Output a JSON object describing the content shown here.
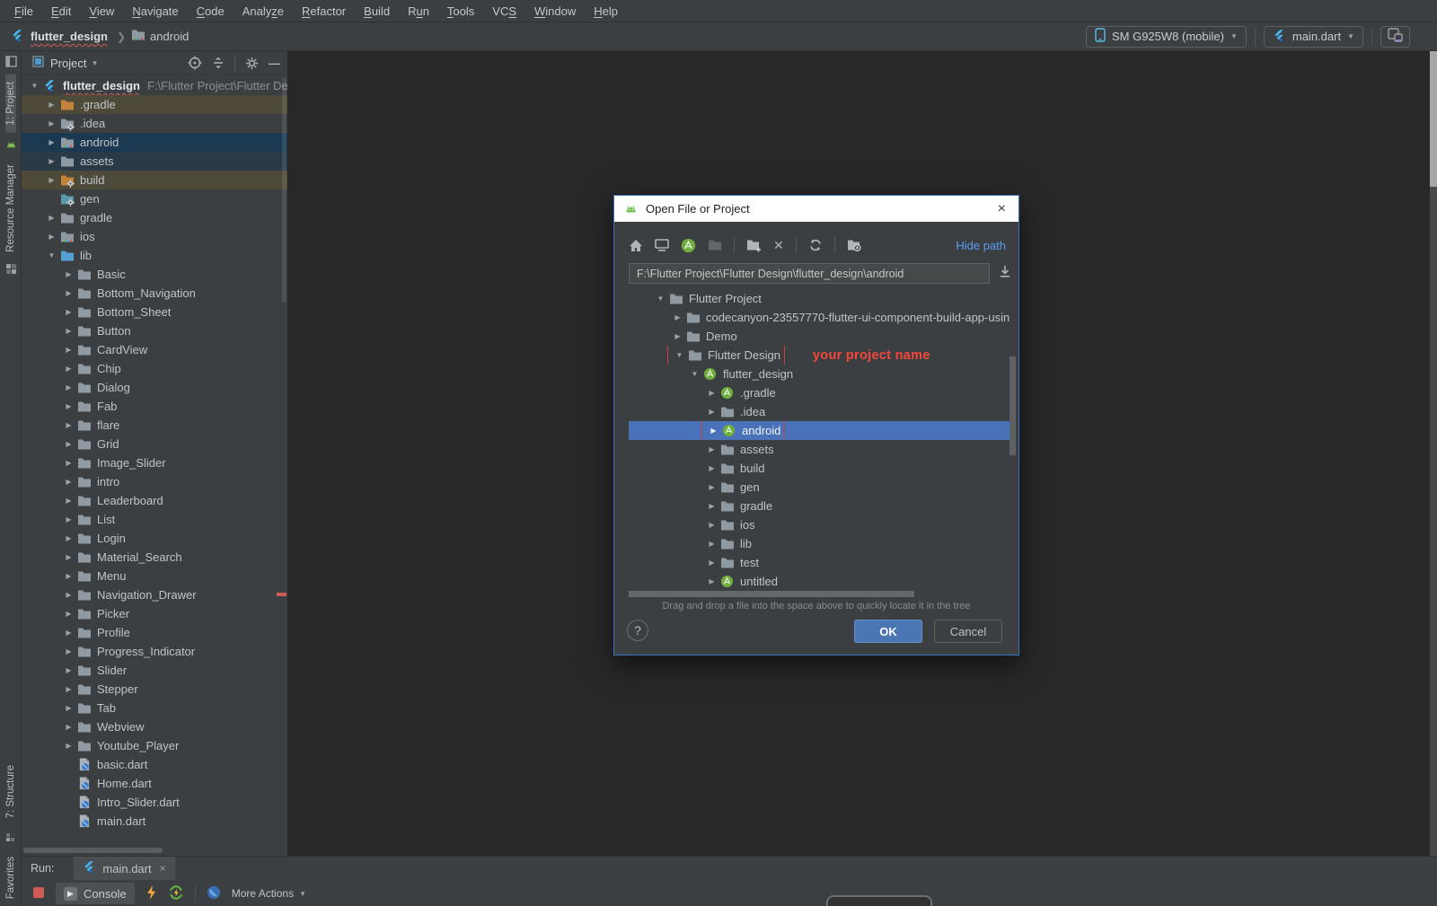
{
  "menu_bar": {
    "items": [
      {
        "label": "File",
        "u": 0
      },
      {
        "label": "Edit",
        "u": 0
      },
      {
        "label": "View",
        "u": 0
      },
      {
        "label": "Navigate",
        "u": 0
      },
      {
        "label": "Code",
        "u": 0
      },
      {
        "label": "Analyze",
        "u": 5
      },
      {
        "label": "Refactor",
        "u": 0
      },
      {
        "label": "Build",
        "u": 0
      },
      {
        "label": "Run",
        "u": 1
      },
      {
        "label": "Tools",
        "u": 0
      },
      {
        "label": "VCS",
        "u": 2
      },
      {
        "label": "Window",
        "u": 0
      },
      {
        "label": "Help",
        "u": 0
      }
    ]
  },
  "breadcrumb": {
    "project": "flutter_design",
    "node": "android"
  },
  "header_right": {
    "device": "SM G925W8 (mobile)",
    "run_config": "main.dart"
  },
  "tool_strip": {
    "top": [
      {
        "icon": "project-tab"
      },
      {
        "label": "1: Project",
        "active": true
      },
      {
        "icon": "android-bot"
      },
      {
        "label": "Resource Manager"
      },
      {
        "icon": "resource-manager"
      }
    ],
    "bottom": [
      {
        "label": "7: Structure"
      },
      {
        "icon": "structure"
      },
      {
        "label": "Favorites"
      }
    ]
  },
  "project_panel": {
    "title": "Project",
    "tree": [
      {
        "name": "flutter_design",
        "depth": 0,
        "icon": "flutter",
        "expanded": true,
        "bold": true,
        "squiggle": true,
        "path": "F:\\Flutter Project\\Flutter Desig"
      },
      {
        "name": ".gradle",
        "depth": 1,
        "icon": "folder-orange",
        "expanded": false,
        "row": "row-olive"
      },
      {
        "name": ".idea",
        "depth": 1,
        "icon": "folder-gear",
        "expanded": false
      },
      {
        "name": "android",
        "depth": 1,
        "icon": "folder-android",
        "expanded": false,
        "row": "row-selleft"
      },
      {
        "name": "assets",
        "depth": 1,
        "icon": "folder",
        "expanded": false,
        "row": "row-dimblue"
      },
      {
        "name": "build",
        "depth": 1,
        "icon": "folder-orange-gear",
        "expanded": false,
        "row": "row-olive"
      },
      {
        "name": "gen",
        "depth": 1,
        "icon": "folder-teal-gear",
        "expanded": null
      },
      {
        "name": "gradle",
        "depth": 1,
        "icon": "folder",
        "expanded": false
      },
      {
        "name": "ios",
        "depth": 1,
        "icon": "folder-android",
        "expanded": false
      },
      {
        "name": "lib",
        "depth": 1,
        "icon": "folder-blue",
        "expanded": true
      },
      {
        "name": "Basic",
        "depth": 2,
        "icon": "folder",
        "expanded": false
      },
      {
        "name": "Bottom_Navigation",
        "depth": 2,
        "icon": "folder",
        "expanded": false
      },
      {
        "name": "Bottom_Sheet",
        "depth": 2,
        "icon": "folder",
        "expanded": false
      },
      {
        "name": "Button",
        "depth": 2,
        "icon": "folder",
        "expanded": false
      },
      {
        "name": "CardView",
        "depth": 2,
        "icon": "folder",
        "expanded": false
      },
      {
        "name": "Chip",
        "depth": 2,
        "icon": "folder",
        "expanded": false
      },
      {
        "name": "Dialog",
        "depth": 2,
        "icon": "folder",
        "expanded": false
      },
      {
        "name": "Fab",
        "depth": 2,
        "icon": "folder",
        "expanded": false
      },
      {
        "name": "flare",
        "depth": 2,
        "icon": "folder",
        "expanded": false
      },
      {
        "name": "Grid",
        "depth": 2,
        "icon": "folder",
        "expanded": false
      },
      {
        "name": "Image_Slider",
        "depth": 2,
        "icon": "folder",
        "expanded": false
      },
      {
        "name": "intro",
        "depth": 2,
        "icon": "folder",
        "expanded": false
      },
      {
        "name": "Leaderboard",
        "depth": 2,
        "icon": "folder",
        "expanded": false
      },
      {
        "name": "List",
        "depth": 2,
        "icon": "folder",
        "expanded": false
      },
      {
        "name": "Login",
        "depth": 2,
        "icon": "folder",
        "expanded": false
      },
      {
        "name": "Material_Search",
        "depth": 2,
        "icon": "folder",
        "expanded": false
      },
      {
        "name": "Menu",
        "depth": 2,
        "icon": "folder",
        "expanded": false
      },
      {
        "name": "Navigation_Drawer",
        "depth": 2,
        "icon": "folder",
        "expanded": false
      },
      {
        "name": "Picker",
        "depth": 2,
        "icon": "folder",
        "expanded": false
      },
      {
        "name": "Profile",
        "depth": 2,
        "icon": "folder",
        "expanded": false
      },
      {
        "name": "Progress_Indicator",
        "depth": 2,
        "icon": "folder",
        "expanded": false
      },
      {
        "name": "Slider",
        "depth": 2,
        "icon": "folder",
        "expanded": false
      },
      {
        "name": "Stepper",
        "depth": 2,
        "icon": "folder",
        "expanded": false
      },
      {
        "name": "Tab",
        "depth": 2,
        "icon": "folder",
        "expanded": false
      },
      {
        "name": "Webview",
        "depth": 2,
        "icon": "folder",
        "expanded": false
      },
      {
        "name": "Youtube_Player",
        "depth": 2,
        "icon": "folder",
        "expanded": false
      },
      {
        "name": "basic.dart",
        "depth": 2,
        "icon": "dart",
        "expanded": null
      },
      {
        "name": "Home.dart",
        "depth": 2,
        "icon": "dart",
        "expanded": null
      },
      {
        "name": "Intro_Slider.dart",
        "depth": 2,
        "icon": "dart",
        "expanded": null
      },
      {
        "name": "main.dart",
        "depth": 2,
        "icon": "dart",
        "expanded": null
      }
    ]
  },
  "dialog": {
    "title": "Open File or Project",
    "hide_path_label": "Hide path",
    "path_value": "F:\\Flutter Project\\Flutter Design\\flutter_design\\android",
    "annotation": "your project name",
    "hint": "Drag and drop a file into the space above to quickly locate it in the tree",
    "help_label": "?",
    "ok_label": "OK",
    "cancel_label": "Cancel",
    "close_label": "×",
    "tree": [
      {
        "name": "Flutter Project",
        "depth": 0,
        "icon": "folder",
        "expanded": true
      },
      {
        "name": "codecanyon-23557770-flutter-ui-component-build-app-usin",
        "depth": 1,
        "icon": "folder",
        "expanded": false
      },
      {
        "name": "Demo",
        "depth": 1,
        "icon": "folder",
        "expanded": false
      },
      {
        "name": "Flutter Design",
        "depth": 1,
        "icon": "folder",
        "expanded": true,
        "box": true,
        "note": "your project name"
      },
      {
        "name": "flutter_design",
        "depth": 2,
        "icon": "as",
        "expanded": true
      },
      {
        "name": ".gradle",
        "depth": 3,
        "icon": "as",
        "expanded": false
      },
      {
        "name": ".idea",
        "depth": 3,
        "icon": "folder",
        "expanded": false
      },
      {
        "name": "android",
        "depth": 3,
        "icon": "as",
        "expanded": false,
        "row": "row-selblue",
        "box": true
      },
      {
        "name": "assets",
        "depth": 3,
        "icon": "folder",
        "expanded": false
      },
      {
        "name": "build",
        "depth": 3,
        "icon": "folder",
        "expanded": false
      },
      {
        "name": "gen",
        "depth": 3,
        "icon": "folder",
        "expanded": false
      },
      {
        "name": "gradle",
        "depth": 3,
        "icon": "folder",
        "expanded": false
      },
      {
        "name": "ios",
        "depth": 3,
        "icon": "folder",
        "expanded": false
      },
      {
        "name": "lib",
        "depth": 3,
        "icon": "folder",
        "expanded": false
      },
      {
        "name": "test",
        "depth": 3,
        "icon": "folder",
        "expanded": false
      },
      {
        "name": "untitled",
        "depth": 3,
        "icon": "as",
        "expanded": false
      }
    ]
  },
  "run_panel": {
    "run_label": "Run:",
    "tab_label": "main.dart",
    "tab_close": "×",
    "console_label": "Console",
    "more_actions_label": "More Actions"
  },
  "colors": {
    "panel_bg": "#3c3f41",
    "editor_bg": "#282828",
    "selection_dialog": "#4a72b8",
    "selection_tree": "#1b3a52",
    "excluded_row": "#4d4a3a",
    "annotation_red": "#f6473b",
    "red_box": "#c4423b",
    "link_blue": "#589df6",
    "ok_button": "#4a77b4",
    "error_stripe": "#cf5b56"
  }
}
